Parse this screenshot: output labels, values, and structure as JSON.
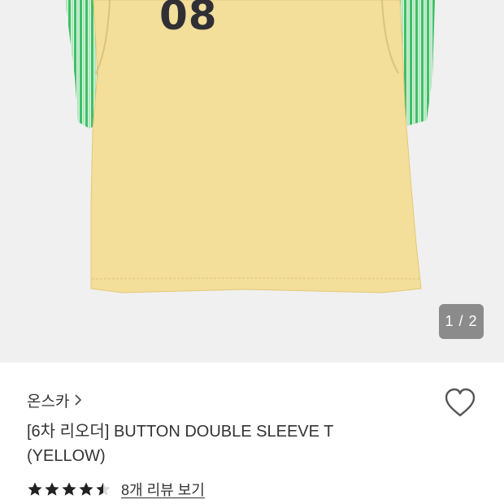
{
  "gallery": {
    "jersey_number": "08",
    "image_counter": "1 / 2",
    "current_image": 1,
    "total_images": 2,
    "shirt_color": "#f3de9a",
    "sleeve_stripe_color": "#3fbf6a"
  },
  "product": {
    "brand": "온스카",
    "title": "[6차 리오더] BUTTON DOUBLE SLEEVE T (YELLOW)",
    "rating": 4.5,
    "rating_max": 5,
    "review_link": "8개 리뷰 보기"
  },
  "icons": {
    "brand_chevron": "chevron-right-icon",
    "wishlist": "heart-outline-icon",
    "star": "star-icon"
  }
}
